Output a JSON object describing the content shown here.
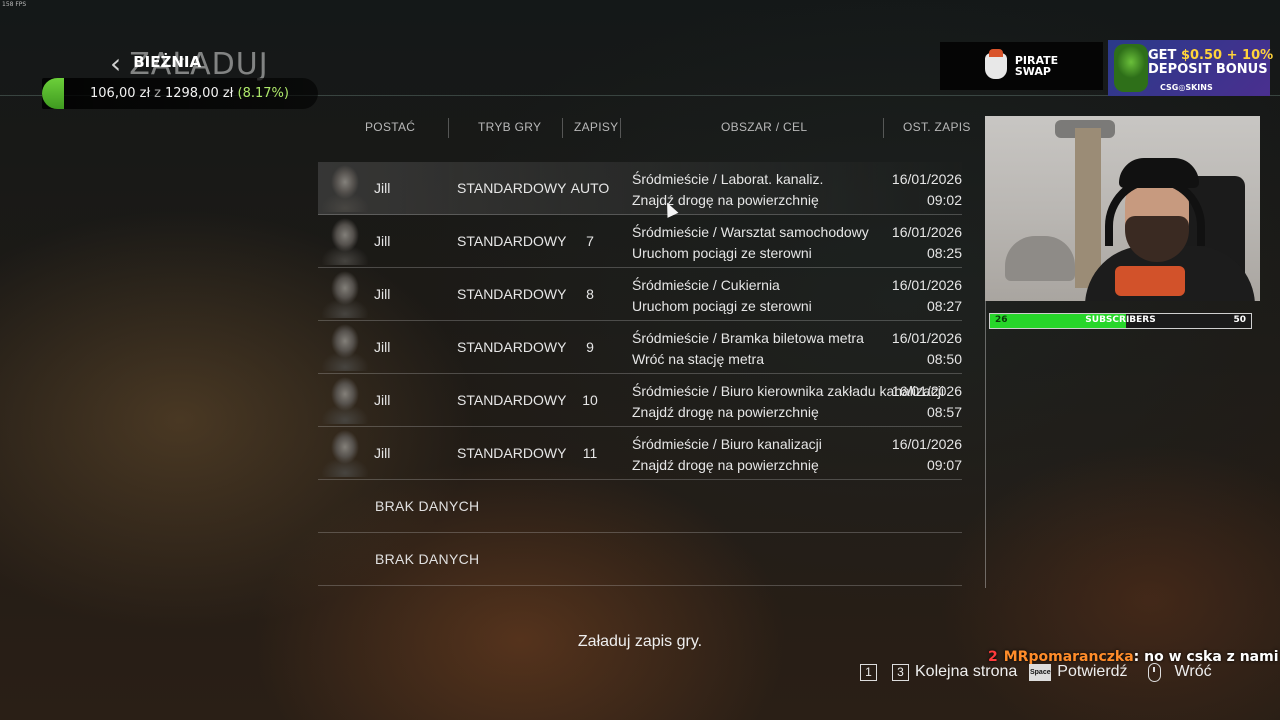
{
  "overlay": {
    "fps": "158 FPS"
  },
  "header": {
    "title": "ZAŁADUJ",
    "subtitle": "BIEŻNIA"
  },
  "balance": {
    "current": "106,00 zł",
    "separator": "z",
    "total": "1298,00 zł",
    "percent": "(8.17%)",
    "accent": "#6ccf3a"
  },
  "table": {
    "headers": [
      "POSTAĆ",
      "TRYB GRY",
      "ZAPISY",
      "OBSZAR / CEL",
      "OST. ZAPIS"
    ],
    "rows": [
      {
        "character": "Jill",
        "mode": "STANDARDOWY",
        "saves": "AUTO",
        "area": "Śródmieście / Laborat. kanaliz.",
        "goal": "Znajdź drogę na powierzchnię",
        "date": "16/01/2026",
        "time": "09:02",
        "selected": true
      },
      {
        "character": "Jill",
        "mode": "STANDARDOWY",
        "saves": "7",
        "area": "Śródmieście / Warsztat samochodowy",
        "goal": "Uruchom pociągi ze sterowni",
        "date": "16/01/2026",
        "time": "08:25"
      },
      {
        "character": "Jill",
        "mode": "STANDARDOWY",
        "saves": "8",
        "area": "Śródmieście / Cukiernia",
        "goal": "Uruchom pociągi ze sterowni",
        "date": "16/01/2026",
        "time": "08:27"
      },
      {
        "character": "Jill",
        "mode": "STANDARDOWY",
        "saves": "9",
        "area": "Śródmieście / Bramka biletowa metra",
        "goal": "Wróć na stację metra",
        "date": "16/01/2026",
        "time": "08:50"
      },
      {
        "character": "Jill",
        "mode": "STANDARDOWY",
        "saves": "10",
        "area": "Śródmieście / Biuro kierownika zakładu kanalizacji",
        "goal": "Znajdź drogę na powierzchnię",
        "date": "16/01/2026",
        "time": "08:57"
      },
      {
        "character": "Jill",
        "mode": "STANDARDOWY",
        "saves": "11",
        "area": "Śródmieście / Biuro kanalizacji",
        "goal": "Znajdź drogę na powierzchnię",
        "date": "16/01/2026",
        "time": "09:07"
      }
    ],
    "empty_rows": [
      "BRAK DANYCH",
      "BRAK DANYCH"
    ]
  },
  "ads": {
    "pirate": {
      "line1": "PIRATE",
      "line2": "SWAP"
    },
    "csgo": {
      "get": "GET",
      "amount": "$0.50 + 10%",
      "line2": "DEPOSIT BONUS",
      "brand": "CSG◎SKINS"
    }
  },
  "subscribers": {
    "current": "26",
    "label": "SUBSCRIBERS",
    "goal": "50",
    "fill_fraction": 0.52,
    "color": "#27d62a"
  },
  "hint": "Załaduj zapis gry.",
  "chat": {
    "badge": "2",
    "user": "MRpomaranczka",
    "message": ": no w cska z nami"
  },
  "controls": {
    "key1": "1",
    "key3": "3",
    "next_page": "Kolejna strona",
    "space_key": "Space",
    "confirm": "Potwierdź",
    "back": "Wróć"
  }
}
